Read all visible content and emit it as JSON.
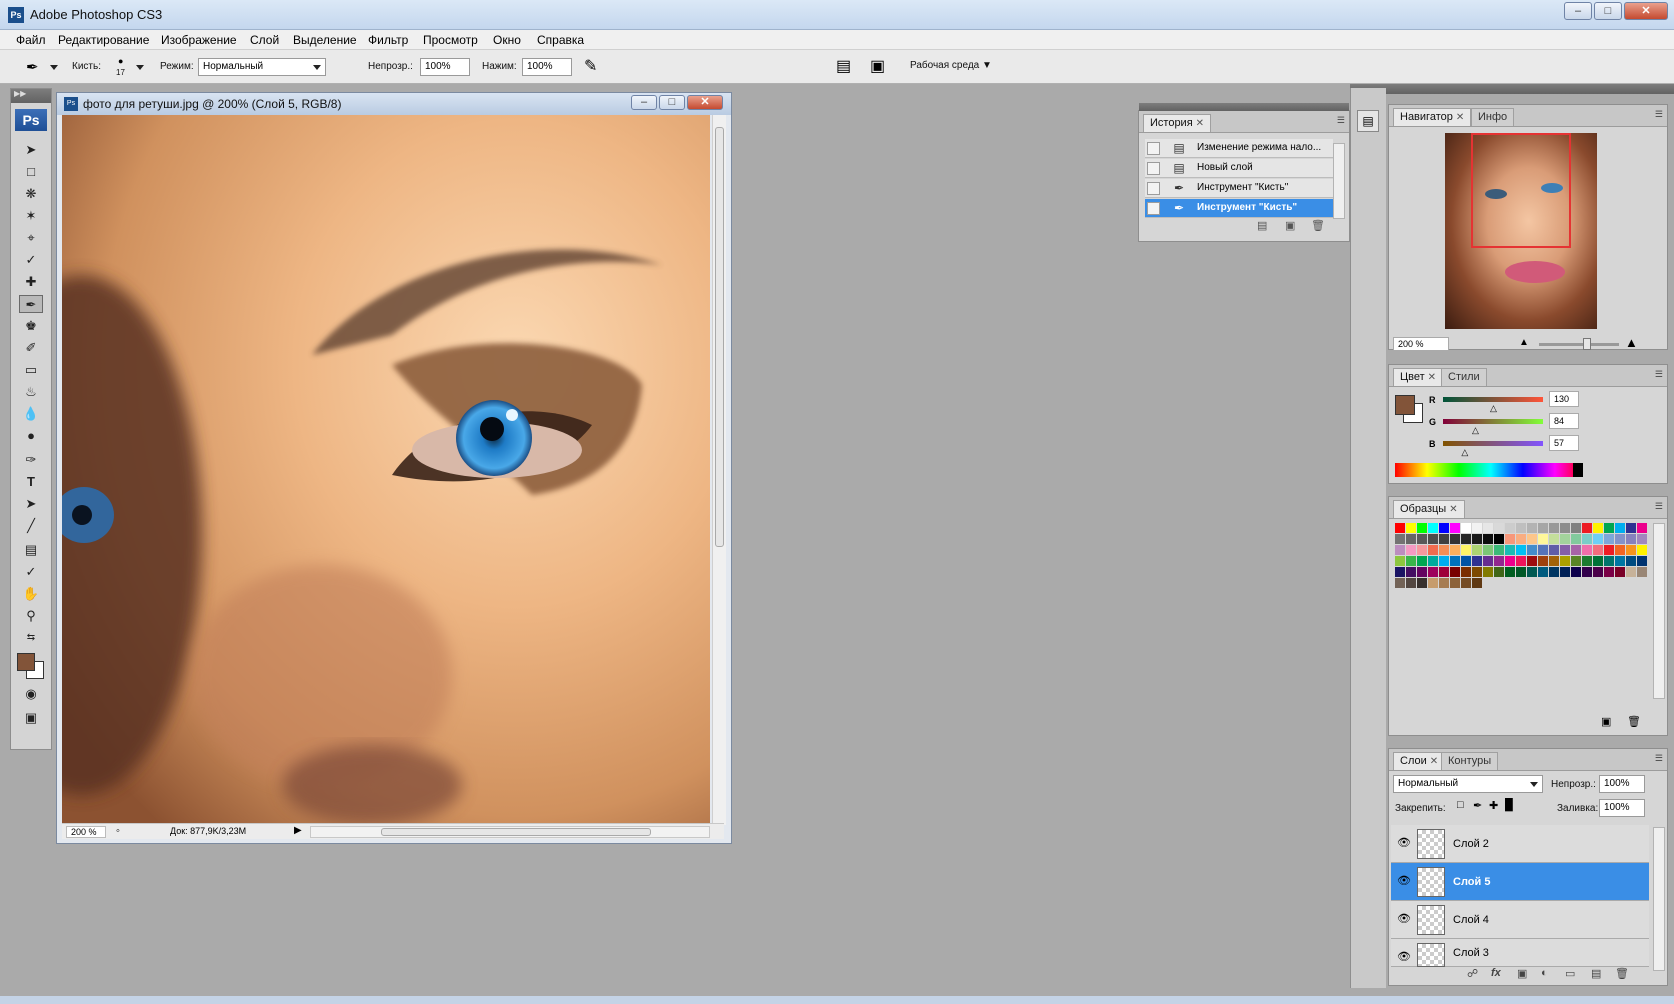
{
  "window": {
    "title": "Adobe Photoshop CS3",
    "app_icon": "Ps"
  },
  "menubar": [
    "Файл",
    "Редактирование",
    "Изображение",
    "Слой",
    "Выделение",
    "Фильтр",
    "Просмотр",
    "Окно",
    "Справка"
  ],
  "options": {
    "brush_label": "Кисть:",
    "brush_size": "17",
    "mode_label": "Режим:",
    "mode_value": "Нормальный",
    "opacity_label": "Непрозр.:",
    "opacity_value": "100%",
    "flow_label": "Нажим:",
    "flow_value": "100%",
    "workspace_label": "Рабочая среда"
  },
  "tools": {
    "logo": "Ps",
    "fg_color": "#825439",
    "bg_color": "#ffffff"
  },
  "document": {
    "title": "фото для ретуши.jpg @ 200% (Слой 5, RGB/8)",
    "zoom": "200 %",
    "doc_info": "Док: 877,9K/3,23M"
  },
  "history": {
    "tab": "История",
    "items": [
      {
        "label": "Изменение режима нало...",
        "icon": "document-icon",
        "selected": false
      },
      {
        "label": "Новый слой",
        "icon": "document-icon",
        "selected": false
      },
      {
        "label": "Инструмент \"Кисть\"",
        "icon": "brush-icon",
        "selected": false
      },
      {
        "label": "Инструмент \"Кисть\"",
        "icon": "brush-icon",
        "selected": true
      }
    ]
  },
  "navigator": {
    "tab_navigator": "Навигатор",
    "tab_info": "Инфо",
    "zoom": "200 %"
  },
  "color": {
    "tab_color": "Цвет",
    "tab_styles": "Стили",
    "r_label": "R",
    "g_label": "G",
    "b_label": "B",
    "r": 130,
    "g": 84,
    "b": 57,
    "r_text": "130",
    "g_text": "84",
    "b_text": "57"
  },
  "swatches": {
    "tab": "Образцы",
    "colors": [
      "#ff0000",
      "#ffff00",
      "#00ff00",
      "#00ffff",
      "#0000ff",
      "#ff00ff",
      "#ffffff",
      "#f2f2f2",
      "#e6e6e6",
      "#d9d9d9",
      "#cccccc",
      "#bfbfbf",
      "#b3b3b3",
      "#a6a6a6",
      "#999999",
      "#8c8c8c",
      "#808080",
      "#ed1c24",
      "#fff200",
      "#00a651",
      "#00aeef",
      "#2e3192",
      "#ec008c",
      "#737373",
      "#666666",
      "#595959",
      "#4d4d4d",
      "#404040",
      "#333333",
      "#262626",
      "#1a1a1a",
      "#0d0d0d",
      "#000000",
      "#f7977a",
      "#f9ad81",
      "#fdc68a",
      "#fff79a",
      "#c4df9b",
      "#a3d39c",
      "#82ca9d",
      "#7bcdc8",
      "#6ecff6",
      "#7ea7d8",
      "#8393ca",
      "#8781bd",
      "#a187be",
      "#bc8dbf",
      "#f49ac2",
      "#f6989d",
      "#f26c4f",
      "#f68e56",
      "#fbaf5d",
      "#fff467",
      "#acd372",
      "#7cc576",
      "#3bb878",
      "#1abbb4",
      "#00bff3",
      "#438ccb",
      "#5574b9",
      "#605ca8",
      "#855fa8",
      "#a763a8",
      "#f06eaa",
      "#f26d7d",
      "#ed1c24",
      "#f26522",
      "#f7941d",
      "#fff200",
      "#8dc63f",
      "#39b54a",
      "#00a651",
      "#00a99d",
      "#00aeef",
      "#0072bc",
      "#0054a6",
      "#2e3192",
      "#662d91",
      "#92278f",
      "#ec008c",
      "#ed145b",
      "#9e0b0f",
      "#a0410d",
      "#a36209",
      "#aba000",
      "#598527",
      "#1a7b30",
      "#007236",
      "#00746b",
      "#0076a3",
      "#004b80",
      "#003471",
      "#1b1464",
      "#440e62",
      "#630460",
      "#9e005d",
      "#9e0039",
      "#790000",
      "#7b2e00",
      "#7d4900",
      "#827b00",
      "#406618",
      "#005e20",
      "#005826",
      "#005952",
      "#005b7f",
      "#003663",
      "#002157",
      "#0d004c",
      "#32004b",
      "#4b0049",
      "#7b0046",
      "#7a0026",
      "#c7b299",
      "#998675",
      "#736357",
      "#534741",
      "#37302d",
      "#c69c6d",
      "#a67c52",
      "#8c6239",
      "#754c24",
      "#603913"
    ]
  },
  "layers": {
    "tab_layers": "Слои",
    "tab_paths": "Контуры",
    "blend_mode": "Нормальный",
    "opacity_label": "Непрозр.:",
    "opacity_value": "100%",
    "lock_label": "Закрепить:",
    "fill_label": "Заливка:",
    "fill_value": "100%",
    "items": [
      {
        "name": "Слой 2",
        "selected": false
      },
      {
        "name": "Слой 5",
        "selected": true
      },
      {
        "name": "Слой 4",
        "selected": false
      },
      {
        "name": "Слой 3",
        "selected": false
      }
    ]
  }
}
